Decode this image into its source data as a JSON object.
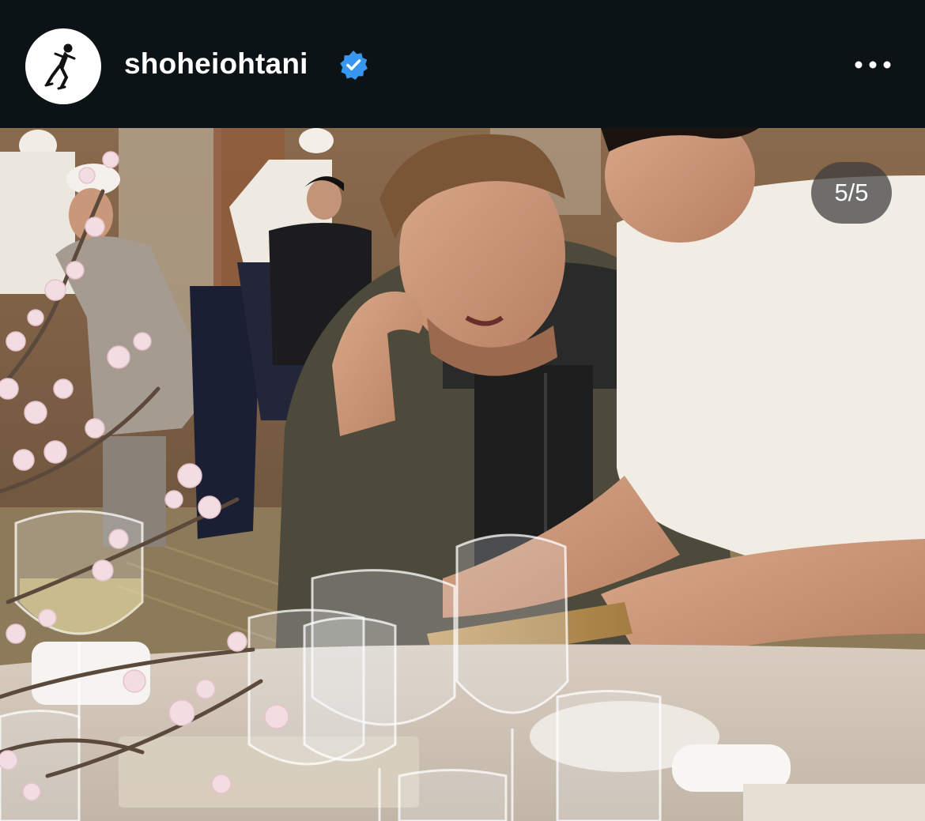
{
  "post": {
    "username": "shoheiohtani",
    "verified": true,
    "avatar_icon": "running-player-silhouette-icon",
    "verified_icon": "verified-badge-icon",
    "more_icon": "more-options-icon"
  },
  "carousel": {
    "counter": "5/5"
  },
  "colors": {
    "header_bg": "#0b1316",
    "verified_blue": "#3797f0",
    "text": "#ffffff"
  }
}
